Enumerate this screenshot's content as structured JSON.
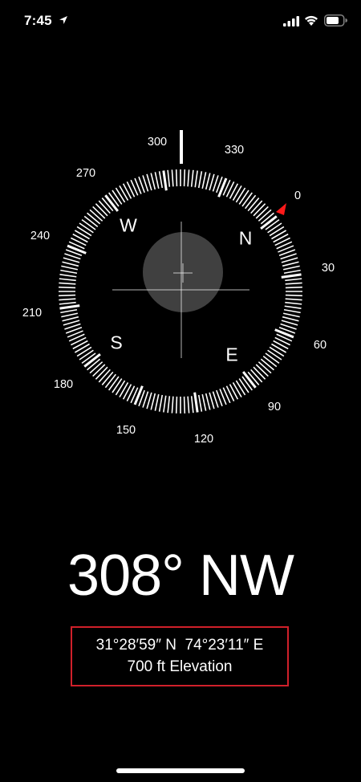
{
  "status_bar": {
    "time": "7:45"
  },
  "compass": {
    "degree_labels": [
      "0",
      "30",
      "60",
      "90",
      "120",
      "150",
      "180",
      "210",
      "240",
      "270",
      "300",
      "330"
    ],
    "cardinals": {
      "north": "N",
      "east": "E",
      "south": "S",
      "west": "W"
    },
    "heading_degrees": 308,
    "accent_color": "#ff1a1a"
  },
  "readout": {
    "heading": "308° NW",
    "coordinates": "31°28′59″ N  74°23′11″ E",
    "elevation": "700 ft Elevation"
  },
  "colors": {
    "background": "#000000",
    "foreground": "#ffffff",
    "highlight_box": "#d0202a"
  }
}
